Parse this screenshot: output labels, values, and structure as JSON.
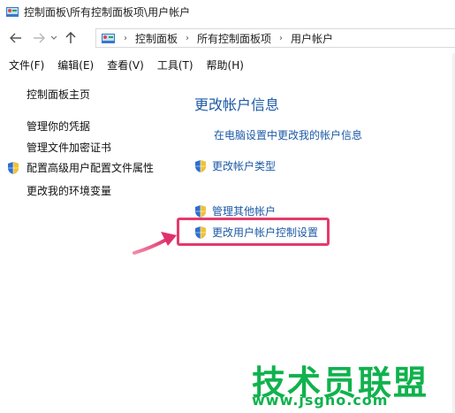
{
  "window": {
    "title": "控制面板\\所有控制面板项\\用户帐户"
  },
  "nav": {
    "back_icon": "back-arrow-icon",
    "forward_icon": "forward-arrow-icon",
    "recent_icon": "chevron-down-icon",
    "up_icon": "up-arrow-icon"
  },
  "address": {
    "crumbs": [
      "控制面板",
      "所有控制面板项",
      "用户帐户"
    ],
    "separator": "›"
  },
  "menu": {
    "items": [
      "文件(F)",
      "编辑(E)",
      "查看(V)",
      "工具(T)",
      "帮助(H)"
    ]
  },
  "sidebar": {
    "home": "控制面板主页",
    "items": [
      "管理你的凭据",
      "管理文件加密证书",
      "配置高级用户配置文件属性",
      "更改我的环境变量"
    ]
  },
  "main": {
    "title": "更改帐户信息",
    "links": [
      "在电脑设置中更改我的帐户信息",
      "更改帐户类型",
      "管理其他帐户",
      "更改用户帐户控制设置"
    ]
  },
  "watermark": {
    "name": "技术员联盟",
    "url": "www.jsgho.com"
  },
  "colors": {
    "link": "#1c5aa6",
    "highlight": "#e33b6a",
    "watermark": "#10b24d"
  }
}
